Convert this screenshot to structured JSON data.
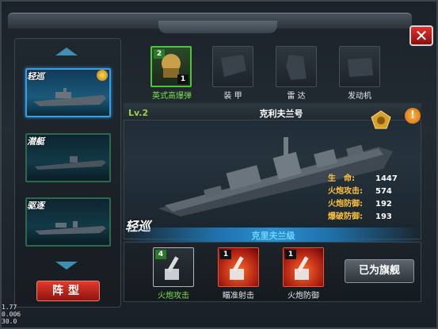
{
  "window": {
    "close_label": "✕"
  },
  "left": {
    "ships": [
      {
        "type_tag": "轻巡",
        "selected": true,
        "has_medal": true
      },
      {
        "type_tag": "潜艇",
        "selected": false,
        "has_medal": false
      },
      {
        "type_tag": "驱逐",
        "selected": false,
        "has_medal": false
      }
    ],
    "formation_button": "阵型"
  },
  "parts": [
    {
      "label": "英式高爆弹",
      "count_top": "2",
      "count_bottom": "1",
      "active": true,
      "icon": "shell-icon"
    },
    {
      "label": "装 甲",
      "active": false,
      "icon": "armor-icon"
    },
    {
      "label": "雷 达",
      "active": false,
      "icon": "radar-icon"
    },
    {
      "label": "发动机",
      "active": false,
      "icon": "engine-icon"
    }
  ],
  "ship": {
    "level": "Lv.2",
    "name": "克利夫兰号",
    "class_tag": "轻巡",
    "class_name": "克里夫兰级",
    "stats": [
      {
        "label": "生　命:",
        "value": "1447"
      },
      {
        "label": "火炮攻击:",
        "value": "574"
      },
      {
        "label": "火炮防御:",
        "value": "192"
      },
      {
        "label": "爆破防御:",
        "value": "193"
      }
    ]
  },
  "skills": [
    {
      "label": "火炮攻击",
      "level": "4",
      "icon": "cannon-attack-icon"
    },
    {
      "label": "瞄准射击",
      "level": "1",
      "icon": "aim-shot-icon"
    },
    {
      "label": "火炮防御",
      "level": "1",
      "icon": "cannon-defense-icon"
    }
  ],
  "flagship_button": "已为旗舰",
  "debug": {
    "line1": "1.77",
    "line2": "0.006",
    "line3": "30.0"
  },
  "colors": {
    "accent_green": "#7de04a",
    "accent_gold": "#ffc23a",
    "accent_blue": "#6fd4ff",
    "accent_red": "#e23a2c"
  }
}
